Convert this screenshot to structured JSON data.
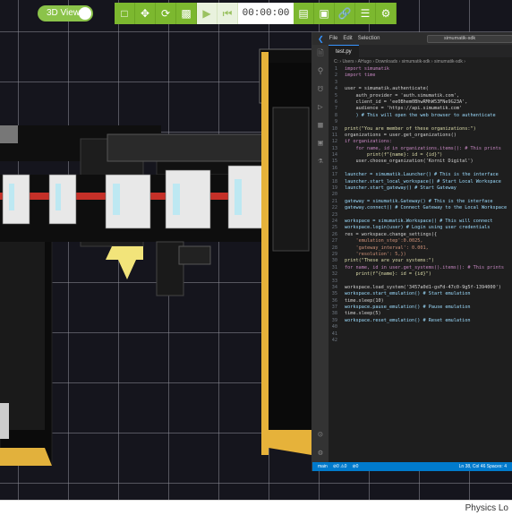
{
  "toolbar": {
    "view_toggle_label": "3D View",
    "timer": "00:00:00"
  },
  "status_label": "Physics Lo",
  "vscode": {
    "menu": [
      "File",
      "Edit",
      "Selection"
    ],
    "search_text": "simumatik-sdk",
    "tab": "test.py",
    "breadcrumb": "C: › Users › AHugo › Downloads › simumatik-sdk › simumatik-sdk ›",
    "status_left": [
      "main",
      "⊘0 ⚠0",
      "⊘0"
    ],
    "status_right": "Ln 38, Col 46   Spaces: 4",
    "code_lines": [
      [
        "1",
        "import simumatik"
      ],
      [
        "2",
        "import time"
      ],
      [
        "3",
        ""
      ],
      [
        "4",
        "user = simumatik.authenticate("
      ],
      [
        "5",
        "    auth_provider = 'auth.simumatik.com',"
      ],
      [
        "6",
        "    client_id = 'ee0Bhem0BhwRMhW53FNe9G23A',"
      ],
      [
        "7",
        "    audience = 'https://api.simumatik.com'"
      ],
      [
        "8",
        "    ) # This will open the web browser to authenticate"
      ],
      [
        "9",
        ""
      ],
      [
        "10",
        "print(\"You are member of these organizations:\")"
      ],
      [
        "11",
        "organizations = user.get_organizations()"
      ],
      [
        "12",
        "if organizations:"
      ],
      [
        "13",
        "    for name, id in organizations.items(): # This prints"
      ],
      [
        "14",
        "        print(f\"{name}: id = {id}\")"
      ],
      [
        "15",
        "    user.choose_organization('Kornit Digital')"
      ],
      [
        "16",
        ""
      ],
      [
        "17",
        "launcher = simumatik.Launcher() # This is the interface"
      ],
      [
        "18",
        "launcher.start_local_workspace() # Start Local Workspace"
      ],
      [
        "19",
        "launcher.start_gateway() # Start Gateway"
      ],
      [
        "20",
        ""
      ],
      [
        "21",
        "gateway = simumatik.Gateway() # This is the interface"
      ],
      [
        "22",
        "gateway.connect() # Connect Gateway to the Local Workspace"
      ],
      [
        "23",
        ""
      ],
      [
        "24",
        "workspace = simumatik.Workspace() # This will connect"
      ],
      [
        "25",
        "workspace.login(user) # Login using user credentials"
      ],
      [
        "26",
        "res = workspace.change_settings({"
      ],
      [
        "27",
        "    'emulation_step':0.0025,"
      ],
      [
        "28",
        "    'gateway_interval': 0.001,"
      ],
      [
        "29",
        "    'resolution': 5,})"
      ],
      [
        "30",
        "print(\"These are your systems:\")"
      ],
      [
        "31",
        "for name, id in user.get_systems().items(): # This prints"
      ],
      [
        "32",
        "    print(f\"{name}: id = {id}\")"
      ],
      [
        "33",
        ""
      ],
      [
        "34",
        "workspace.load_system('3457a0d1-gsFd-47c0-9g5f-1394000')"
      ],
      [
        "35",
        "workspace.start_emulation() # Start emulation"
      ],
      [
        "36",
        "time.sleep(10)"
      ],
      [
        "37",
        "workspace.pause_emulation() # Pause emulation"
      ],
      [
        "38",
        "time.sleep(5)"
      ],
      [
        "39",
        "workspace.reset_emulation() # Reset emulation"
      ],
      [
        "40",
        ""
      ],
      [
        "41",
        ""
      ],
      [
        "42",
        ""
      ]
    ]
  },
  "colors": {
    "accent_green": "#7cb82f",
    "vscode_blue": "#007acc"
  }
}
